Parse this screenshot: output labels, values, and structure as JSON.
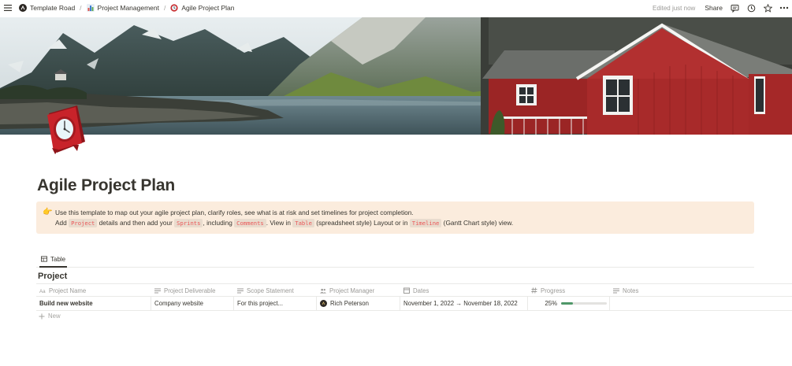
{
  "breadcrumbs": [
    {
      "label": "Template Road",
      "icon": "template-road-logo-icon"
    },
    {
      "label": "Project Management",
      "icon": "bar-chart-icon"
    },
    {
      "label": "Agile Project Plan",
      "icon": "clock-icon"
    }
  ],
  "topbar": {
    "edited": "Edited just now",
    "share": "Share"
  },
  "page": {
    "title": "Agile Project Plan",
    "icon": "alarm-clock-icon"
  },
  "callout": {
    "emoji": "👉",
    "line1": "Use this template to map out your agile project plan, clarify roles, see what is at risk and set timelines for project completion.",
    "line2_parts": {
      "p1": "Add ",
      "c1": "Project",
      "p2": " details and then add your ",
      "c2": "Sprints",
      "p3": ", including ",
      "c3": "Comments",
      "p4": ". View in ",
      "c4": "Table",
      "p5": " (spreadsheet style) Layout or in ",
      "c5": "Timeline",
      "p6": " (Gantt Chart style) view."
    }
  },
  "view": {
    "tab_label": "Table"
  },
  "database": {
    "title": "Project",
    "columns": [
      {
        "label": "Project Name",
        "icon": "title-aa-icon"
      },
      {
        "label": "Project Deliverable",
        "icon": "text-lines-icon"
      },
      {
        "label": "Scope Statement",
        "icon": "text-lines-icon"
      },
      {
        "label": "Project Manager",
        "icon": "people-icon"
      },
      {
        "label": "Dates",
        "icon": "calendar-icon"
      },
      {
        "label": "Progress",
        "icon": "hash-icon"
      },
      {
        "label": "Notes",
        "icon": "text-lines-icon"
      }
    ],
    "rows": [
      {
        "name": "Build new website",
        "deliverable": "Company website",
        "scope": "For this project...",
        "manager": "Rich Peterson",
        "dates": "November 1, 2022 → November 18, 2022",
        "progress_label": "25%",
        "progress": 0.25,
        "notes": ""
      }
    ],
    "new_label": "New"
  },
  "colors": {
    "callout_bg": "#fbecdd",
    "code_text": "#eb5757",
    "progress_fill": "#4f9768",
    "house_red": "#a82a2a"
  }
}
